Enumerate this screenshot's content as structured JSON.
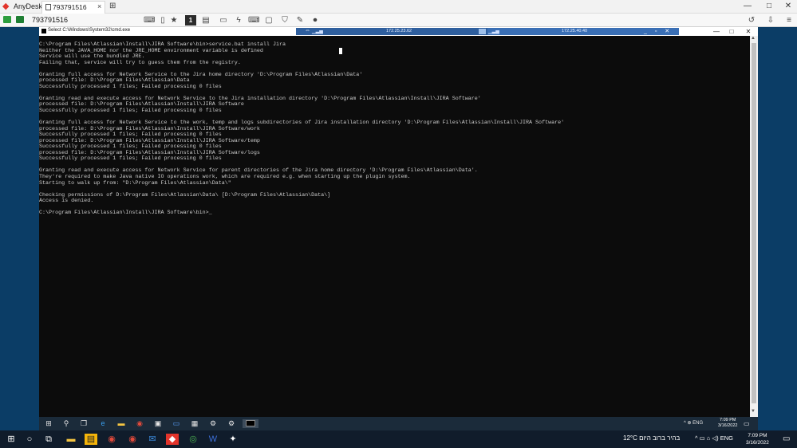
{
  "anydesk": {
    "app_name": "AnyDesk",
    "tab_label": "793791516",
    "tab_close": "×",
    "new_tab": "⊞",
    "win_min": "—",
    "win_max": "□",
    "win_close": "✕",
    "address_id": "793791516",
    "toolbar_active_label": "1",
    "brand_color": "#e2342b"
  },
  "cmd": {
    "title": "Select C:\\Windows\\System32\\cmd.exe",
    "min": "—",
    "max": "□",
    "close": "✕",
    "lines": [
      "C:\\Program Files\\Atlassian\\Install\\JIRA Software\\bin>service.bat install Jira",
      "Neither the JAVA_HOME nor the JRE_HOME environment variable is defined",
      "Service will use the bundled JRE.",
      "Failing that, service will try to guess them from the registry.",
      "",
      "Granting full access for Network Service to the Jira home directory 'D:\\Program Files\\Atlassian\\Data'",
      "processed file: D:\\Program Files\\Atlassian\\Data",
      "Successfully processed 1 files; Failed processing 0 files",
      "",
      "Granting read and execute access for Network Service to the Jira installation directory 'D:\\Program Files\\Atlassian\\Install\\JIRA Software'",
      "processed file: D:\\Program Files\\Atlassian\\Install\\JIRA Software",
      "Successfully processed 1 files; Failed processing 0 files",
      "",
      "Granting full access for Network Service to the work, temp and logs subdirectories of Jira installation directory 'D:\\Program Files\\Atlassian\\Install\\JIRA Software'",
      "processed file: D:\\Program Files\\Atlassian\\Install\\JIRA Software/work",
      "Successfully processed 1 files; Failed processing 0 files",
      "processed file: D:\\Program Files\\Atlassian\\Install\\JIRA Software/temp",
      "Successfully processed 1 files; Failed processing 0 files",
      "processed file: D:\\Program Files\\Atlassian\\Install\\JIRA Software/logs",
      "Successfully processed 1 files; Failed processing 0 files",
      "",
      "Granting read and execute access for Network Service for parent directories of the Jira home directory 'D:\\Program Files\\Atlassian\\Data'.",
      "They're required to make Java native IO operations work, which are required e.g. when starting up the plugin system.",
      "Starting to walk up from: \"D:\\Program Files\\Atlassian\\Data\\\"",
      "",
      "Checking permissions of D:\\Program Files\\Atlassian\\Data\\ [D:\\Program Files\\Atlassian\\Data\\]",
      "Access is denied.",
      "",
      "C:\\Program Files\\Atlassian\\Install\\JIRA Software\\bin>_"
    ]
  },
  "rdp_bar": {
    "ip_left": "172.25.23.62",
    "ip_right": "172.25.40.40",
    "controls": "_ ▫ ✕"
  },
  "remote_taskbar": {
    "tray": "^  ⊕  ENG",
    "time": "7:09 PM",
    "date": "3/16/2022",
    "notif": "▭"
  },
  "taskbar": {
    "weather": "12°C  בהיר ברוב היום",
    "tray": "^  ▭  ⌂  ◁)  ENG",
    "time": "7:09 PM",
    "date": "3/16/2022",
    "notif": "▭"
  }
}
